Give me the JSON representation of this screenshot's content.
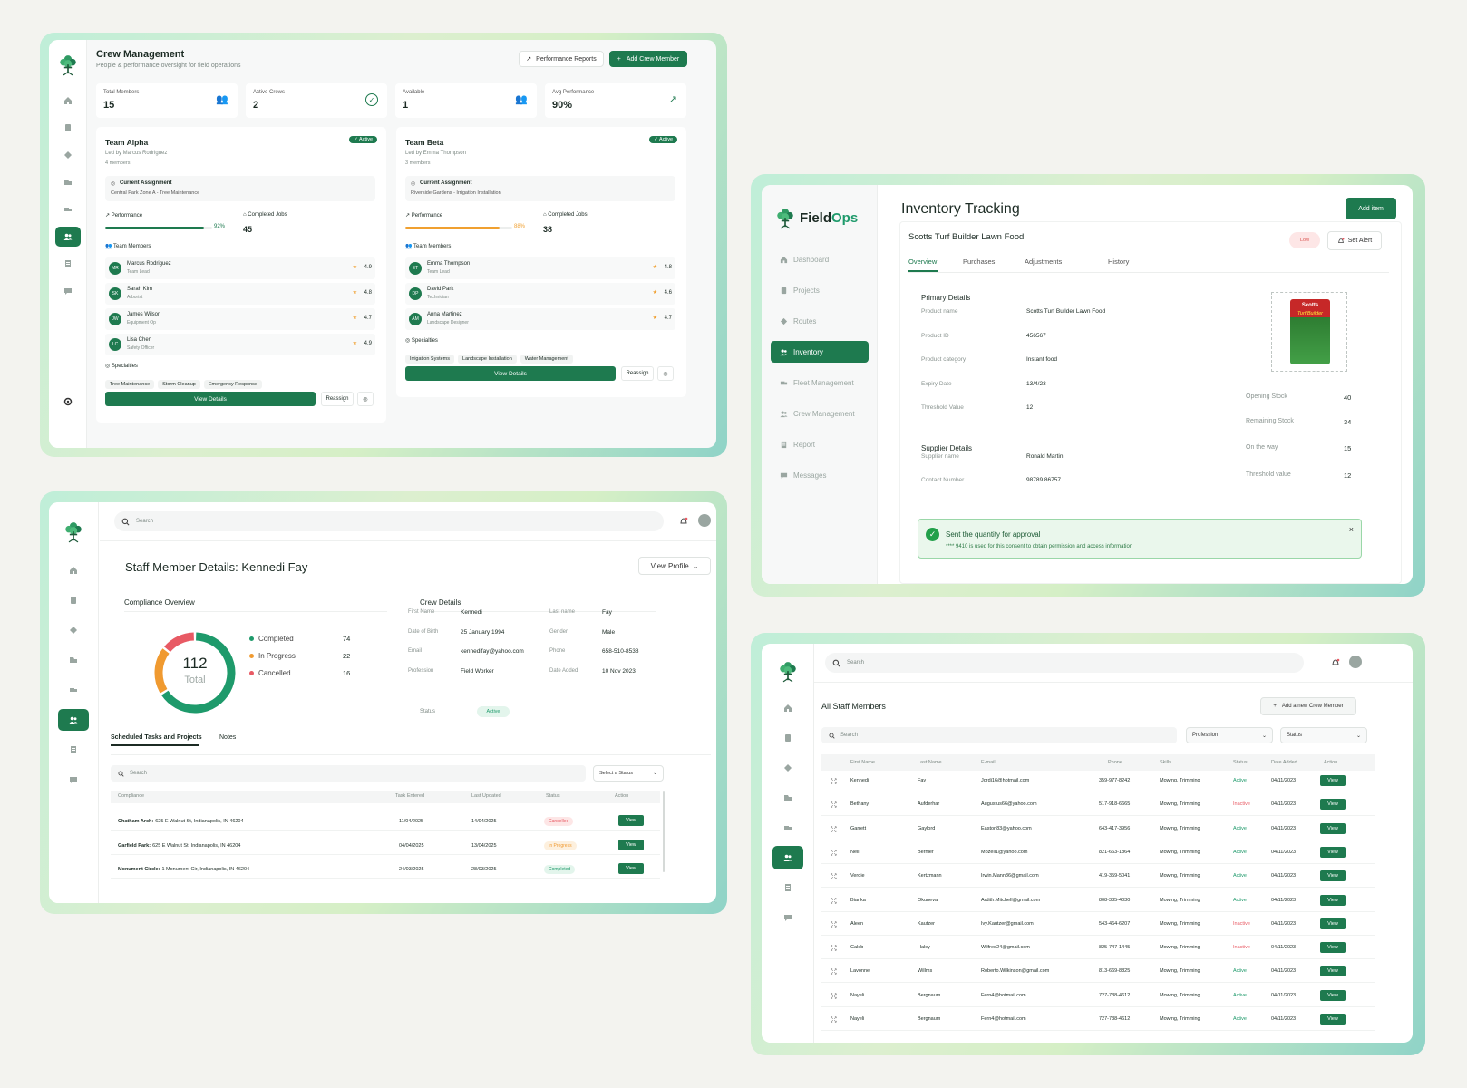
{
  "crew": {
    "title": "Crew Management",
    "subtitle": "People & performance oversight for field operations",
    "perf_reports": "Performance Reports",
    "add_member": "Add Crew Member",
    "stats": [
      {
        "label": "Total Members",
        "value": "15"
      },
      {
        "label": "Active Crews",
        "value": "2"
      },
      {
        "label": "Available",
        "value": "1"
      },
      {
        "label": "Avg Performance",
        "value": "90%"
      }
    ],
    "teams": [
      {
        "name": "Team Alpha",
        "lead": "Led by Marcus Rodriguez",
        "count": "4 members",
        "status": "Active",
        "assignment_label": "Current Assignment",
        "assignment": "Central Park Zone A - Tree Maintenance",
        "perf_label": "Performance",
        "perf_value": "92%",
        "perf_fraction": 0.92,
        "perf_color": "#1e7a4f",
        "jobs_label": "Completed Jobs",
        "jobs": "45",
        "members_label": "Team Members",
        "members": [
          {
            "initials": "MR",
            "name": "Marcus Rodriguez",
            "role": "Team Lead",
            "rating": "4.9"
          },
          {
            "initials": "SK",
            "name": "Sarah Kim",
            "role": "Arborist",
            "rating": "4.8"
          },
          {
            "initials": "JW",
            "name": "James Wilson",
            "role": "Equipment Op",
            "rating": "4.7"
          },
          {
            "initials": "LC",
            "name": "Lisa Chen",
            "role": "Safety Officer",
            "rating": "4.9"
          }
        ],
        "spec_label": "Specialties",
        "specialties": [
          "Tree Maintenance",
          "Storm Cleanup",
          "Emergency Response"
        ],
        "view": "View Details",
        "reassign": "Reassign"
      },
      {
        "name": "Team Beta",
        "lead": "Led by Emma Thompson",
        "count": "3 members",
        "status": "Active",
        "assignment_label": "Current Assignment",
        "assignment": "Riverside Gardens - Irrigation Installation",
        "perf_label": "Performance",
        "perf_value": "88%",
        "perf_fraction": 0.88,
        "perf_color": "#f0a030",
        "jobs_label": "Completed Jobs",
        "jobs": "38",
        "members_label": "Team Members",
        "members": [
          {
            "initials": "ET",
            "name": "Emma Thompson",
            "role": "Team Lead",
            "rating": "4.8"
          },
          {
            "initials": "DP",
            "name": "David Park",
            "role": "Technician",
            "rating": "4.6"
          },
          {
            "initials": "AM",
            "name": "Anna Martinez",
            "role": "Landscape Designer",
            "rating": "4.7"
          }
        ],
        "spec_label": "Specialties",
        "specialties": [
          "Irrigation Systems",
          "Landscape Installation",
          "Water Management"
        ],
        "view": "View Details",
        "reassign": "Reassign"
      }
    ]
  },
  "inventory": {
    "brand_a": "Field",
    "brand_b": "Ops",
    "nav": [
      "Dashboard",
      "Projects",
      "Routes",
      "Inventory",
      "Fleet Management",
      "Crew Management",
      "Report",
      "Messages"
    ],
    "title": "Inventory Tracking",
    "add_item": "Add item",
    "product": "Scotts Turf Builder Lawn Food",
    "low_badge": "Low",
    "set_alert": "Set Alert",
    "tabs": [
      "Overview",
      "Purchases",
      "Adjustments",
      "History"
    ],
    "primary_title": "Primary Details",
    "primary": [
      {
        "k": "Product name",
        "v": "Scotts Turf Builder Lawn Food"
      },
      {
        "k": "Product ID",
        "v": "456567"
      },
      {
        "k": "Product category",
        "v": "Instant food"
      },
      {
        "k": "Expiry Date",
        "v": "13/4/23"
      },
      {
        "k": "Threshold Value",
        "v": "12"
      }
    ],
    "supplier_title": "Supplier Details",
    "supplier": [
      {
        "k": "Supplier name",
        "v": "Ronald Martin"
      },
      {
        "k": "Contact Number",
        "v": "98789 86757"
      }
    ],
    "stock": [
      {
        "k": "Opening Stock",
        "v": "40"
      },
      {
        "k": "Remaining  Stock",
        "v": "34"
      },
      {
        "k": "On the way",
        "v": "15"
      },
      {
        "k": "Threshold value",
        "v": "12"
      }
    ],
    "package_brand": "Scotts",
    "package_name": "Turf Builder",
    "toast_title": "Sent the quantity for approval",
    "toast_body": "**** 9410 is used for this consent to obtain permission and access information"
  },
  "staff": {
    "search_placeholder": "Search",
    "title": "Staff Member Details: Kennedi Fay",
    "view_profile": "View Profile",
    "compliance_title": "Compliance Overview",
    "total": "112",
    "total_label": "Total",
    "legend": [
      {
        "label": "Completed",
        "value": "74",
        "color": "#1e9a6b"
      },
      {
        "label": "In Progress",
        "value": "22",
        "color": "#f09a30"
      },
      {
        "label": "Cancelled",
        "value": "16",
        "color": "#e85a64"
      }
    ],
    "crew_title": "Crew Details",
    "details": [
      {
        "k": "First Name",
        "v": "Kennedi",
        "k2": "Last name",
        "v2": "Fay"
      },
      {
        "k": "Date of Birth",
        "v": "25 January 1994",
        "k2": "Gender",
        "v2": "Male"
      },
      {
        "k": "Email",
        "v": "kennedifay@yahoo.com",
        "k2": "Phone",
        "v2": "658-510-8538"
      },
      {
        "k": "Profession",
        "v": "Field Worker",
        "k2": "Date Added",
        "v2": "10 Nov 2023"
      }
    ],
    "status_label": "Status",
    "status_value": "Active",
    "tabs": [
      "Scheduled Tasks and Projects",
      "Notes"
    ],
    "task_search": "Search",
    "select_status": "Select a Status",
    "task_cols": [
      "Compliance",
      "Task Entered",
      "Last Updated",
      "Status",
      "Action"
    ],
    "tasks": [
      {
        "name": "Chatham Arch:",
        "addr": "625 E Walnut St, Indianapolis, IN 46204",
        "entered": "11/04/2025",
        "updated": "14/04/2025",
        "status": "Cancelled",
        "action": "View"
      },
      {
        "name": "Garfield Park:",
        "addr": "625 E Walnut St, Indianapolis, IN 46204",
        "entered": "04/04/2025",
        "updated": "13/04/2025",
        "status": "In Progress",
        "action": "View"
      },
      {
        "name": "Monument Circle:",
        "addr": "1 Monument Cir, Indianapolis, IN 46204",
        "entered": "24/03/2025",
        "updated": "28/03/2025",
        "status": "Completed",
        "action": "View"
      }
    ]
  },
  "allstaff": {
    "search_placeholder": "Search",
    "title": "All Staff Members",
    "add_btn": "Add a new Crew Member",
    "filter_search": "Search",
    "profession": "Profession",
    "status": "Status",
    "cols": [
      "First Name",
      "Last Name",
      "E-mail",
      "Phone",
      "Skills",
      "Status",
      "Date Added",
      "Action"
    ],
    "rows": [
      [
        "Kennedi",
        "Fay",
        "Jordi16@hotmail.com",
        "359-977-8242",
        "Mowing, Trimming",
        "Active",
        "04/11/2023",
        "View"
      ],
      [
        "Bethany",
        "Aufderhar",
        "Augustus66@yahoo.com",
        "517-918-6665",
        "Mowing, Trimming",
        "Inactive",
        "04/11/2023",
        "View"
      ],
      [
        "Garrett",
        "Gaylord",
        "Easton83@yahoo.com",
        "643-417-3956",
        "Mowing, Trimming",
        "Active",
        "04/11/2023",
        "View"
      ],
      [
        "Neil",
        "Bernier",
        "Mozell1@yahoo.com",
        "821-663-1864",
        "Mowing, Trimming",
        "Active",
        "04/11/2023",
        "View"
      ],
      [
        "Verdie",
        "Kertzmann",
        "Irwin.Mann86@gmail.com",
        "419-359-5041",
        "Mowing, Trimming",
        "Active",
        "04/11/2023",
        "View"
      ],
      [
        "Bianka",
        "Okuneva",
        "Ardith.Mitchell@gmail.com",
        "808-335-4030",
        "Mowing, Trimming",
        "Active",
        "04/11/2023",
        "View"
      ],
      [
        "Aleen",
        "Kautzer",
        "Ivy.Kautzer@gmail.com",
        "543-464-6207",
        "Mowing, Trimming",
        "Inactive",
        "04/11/2023",
        "View"
      ],
      [
        "Caleb",
        "Haley",
        "Wilfred24@gmail.com",
        "825-747-1445",
        "Mowing, Trimming",
        "Inactive",
        "04/11/2023",
        "View"
      ],
      [
        "Lavonne",
        "Willms",
        "Roberto.Wilkinson@gmail.com",
        "813-669-8825",
        "Mowing, Trimming",
        "Active",
        "04/11/2023",
        "View"
      ],
      [
        "Nayeli",
        "Bergnaum",
        "Fern4@hotmail.com",
        "727-738-4612",
        "Mowing, Trimming",
        "Active",
        "04/11/2023",
        "View"
      ],
      [
        "Nayeli",
        "Bergnaum",
        "Fern4@hotmail.com",
        "727-738-4612",
        "Mowing, Trimming",
        "Active",
        "04/11/2023",
        "View"
      ]
    ]
  },
  "colors": {
    "brand": "#1e7a4f",
    "active": "#1e9a6b",
    "inactive": "#e85a64",
    "warn": "#f0a030"
  }
}
